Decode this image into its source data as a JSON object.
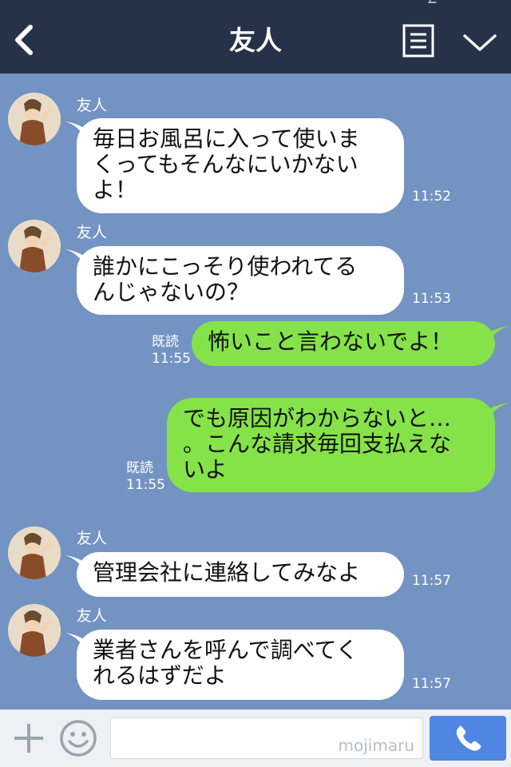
{
  "header": {
    "title": "友人"
  },
  "messages": [
    {
      "side": "left",
      "sender": "友人",
      "lines": [
        "毎日お風呂に入って使いま",
        "くってもそんなにいかない",
        "よ！"
      ],
      "time": "11:52"
    },
    {
      "side": "left",
      "sender": "友人",
      "lines": [
        "誰かにこっそり使われてる",
        "んじゃないの？"
      ],
      "time": "11:53"
    },
    {
      "side": "right",
      "read": "既読",
      "lines": [
        "怖いこと言わないでよ！"
      ],
      "time": "11:55"
    },
    {
      "side": "right",
      "read": "既読",
      "lines": [
        "でも原因がわからないと…",
        "。こんな請求毎回支払えな",
        "いよ"
      ],
      "time": "11:55"
    },
    {
      "side": "left",
      "sender": "友人",
      "lines": [
        "管理会社に連絡してみなよ"
      ],
      "time": "11:57"
    },
    {
      "side": "left",
      "sender": "友人",
      "lines": [
        "業者さんを呼んで調べてく",
        "れるはずだよ"
      ],
      "time": "11:57"
    }
  ],
  "footer": {
    "input_value": "",
    "watermark": "mojimaru"
  },
  "colors": {
    "header_bg": "#263248",
    "chat_bg": "#7393c2",
    "left_bubble": "#ffffff",
    "right_bubble": "#85e249",
    "call_button": "#4f86e3"
  }
}
